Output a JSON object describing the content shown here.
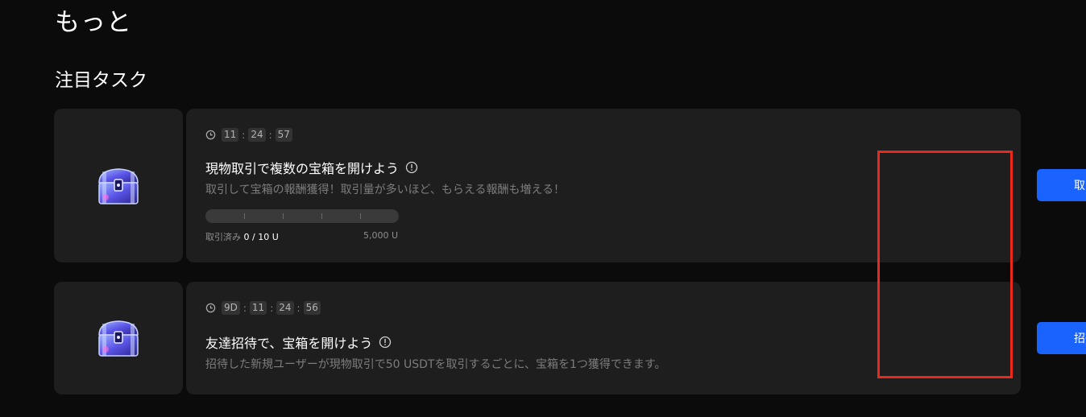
{
  "page": {
    "title": "もっと",
    "section_title": "注目タスク"
  },
  "tasks": [
    {
      "timer": [
        "11",
        "24",
        "57"
      ],
      "title": "現物取引で複数の宝箱を開けよう",
      "description": "取引して宝箱の報酬獲得！取引量が多いほど、もらえる報酬も増える！",
      "progress": {
        "label": "取引済み",
        "value_text": "0 / 10 U",
        "max_text": "5,000 U",
        "fraction": 0
      },
      "button_label": "取引"
    },
    {
      "timer": [
        "9D",
        "11",
        "24",
        "56"
      ],
      "title": "友達招待で、宝箱を開けよう",
      "description": "招待した新規ユーザーが現物取引で50 USDTを取引するごとに、宝箱を1つ獲得できます。",
      "button_label": "招待"
    }
  ],
  "icons": {
    "timer": "clock-icon",
    "info": "info-circle-icon",
    "reward": "treasure-chest-icon"
  },
  "colors": {
    "background": "#0b0b0b",
    "card": "#1e1e1e",
    "accent": "#1a63ff",
    "highlight": "#e8291c"
  }
}
